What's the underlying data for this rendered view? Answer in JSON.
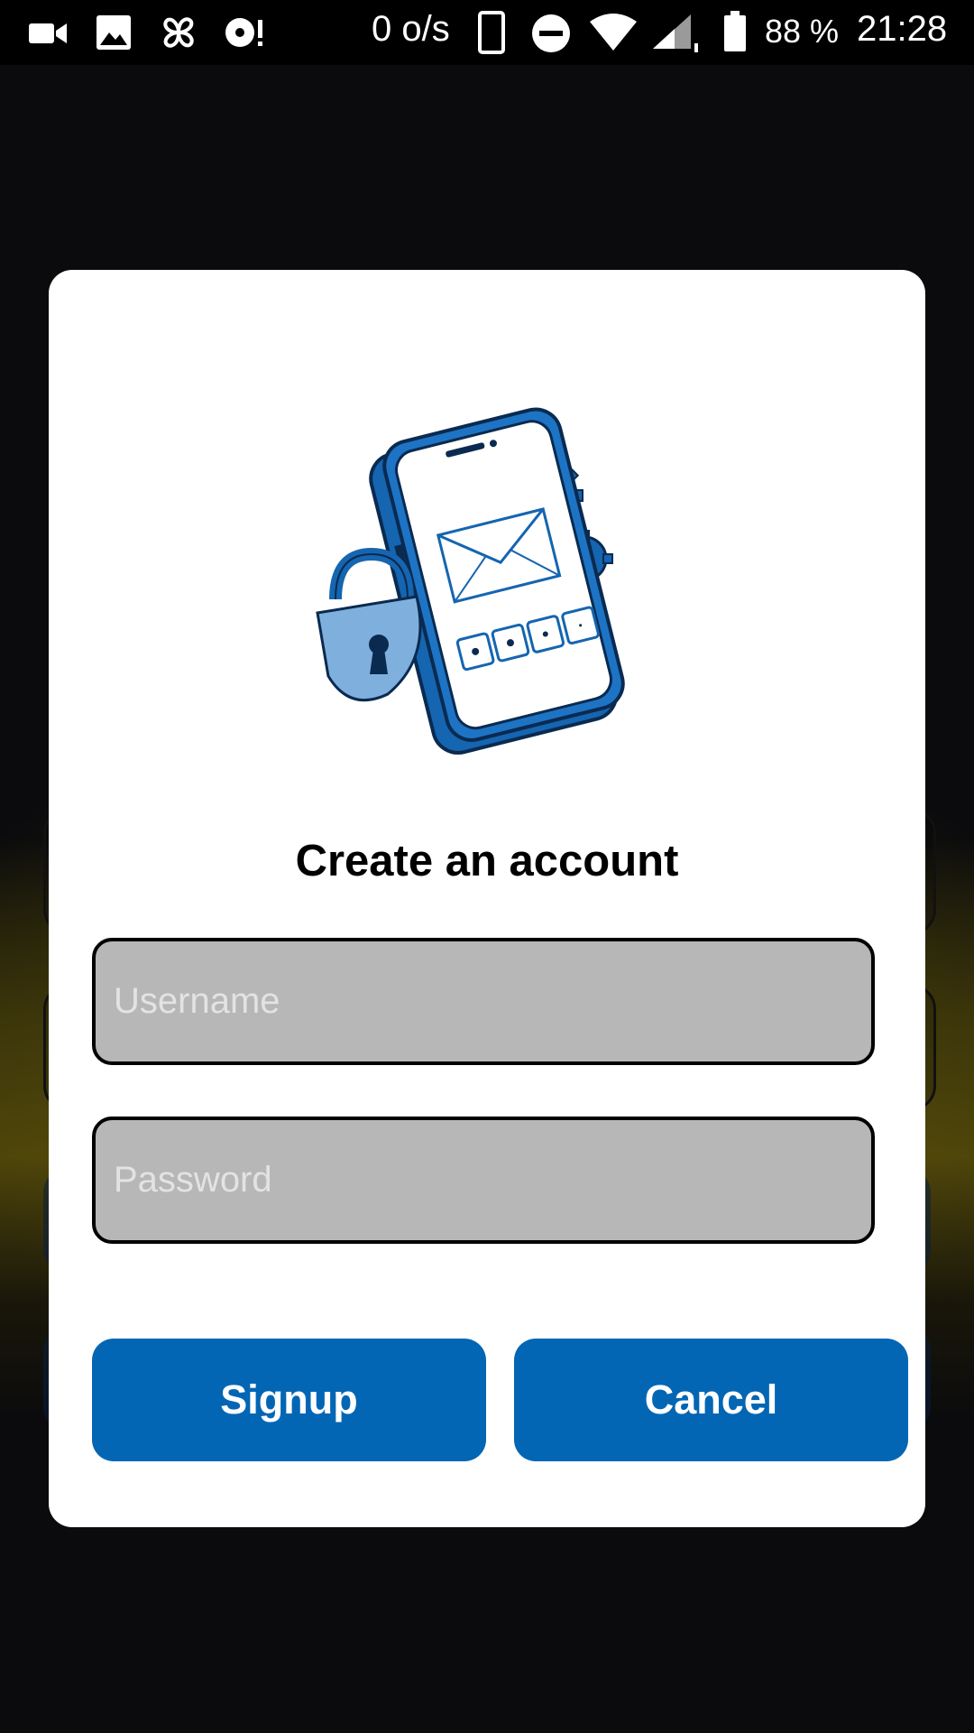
{
  "status_bar": {
    "net_speed": "0 o/s",
    "battery": "88 %",
    "time": "21:28",
    "icons": [
      "video-camera-icon",
      "image-icon",
      "pinwheel-icon",
      "record-alert-icon",
      "phone-outline-icon",
      "do-not-disturb-icon",
      "wifi-icon",
      "cell-signal-icon",
      "battery-icon"
    ]
  },
  "dialog": {
    "title": "Create an account",
    "illustration": "phone-lock-gears-illustration",
    "username": {
      "value": "",
      "placeholder": "Username"
    },
    "password": {
      "value": "",
      "placeholder": "Password"
    },
    "buttons": {
      "signup": "Signup",
      "cancel": "Cancel"
    }
  },
  "colors": {
    "accent": "#0366b4",
    "input_bg": "#b7b7b7",
    "illustration_blue": "#1565b0",
    "illustration_light": "#7fb0dd"
  }
}
